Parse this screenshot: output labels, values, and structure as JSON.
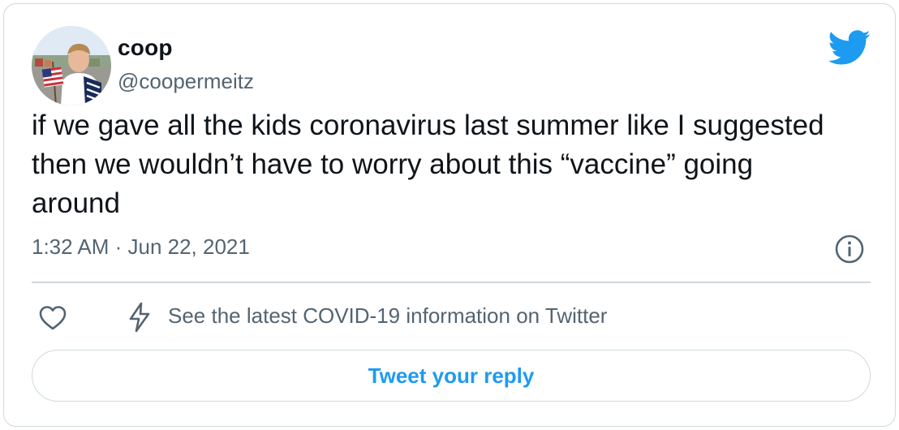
{
  "user": {
    "display_name": "coop",
    "handle": "@coopermeitz",
    "avatar_icon": "profile-photo"
  },
  "tweet": {
    "text": "if we gave all the kids coronavirus last summer like I suggested then we wouldn’t have to worry about this “vaccine” going around",
    "timestamp": "1:32 AM · Jun 22, 2021"
  },
  "actions": {
    "like_icon": "heart-icon",
    "covid_icon": "lightning-bolt-icon",
    "covid_link": "See the latest COVID-19 information on Twitter",
    "reply_label": "Tweet your reply"
  },
  "icons": {
    "brand": "twitter-bird-icon",
    "info": "info-icon"
  },
  "colors": {
    "brand_blue": "#1d9bf0",
    "text_primary": "#0f1419",
    "text_secondary": "#536471",
    "border": "#cfd9de"
  }
}
